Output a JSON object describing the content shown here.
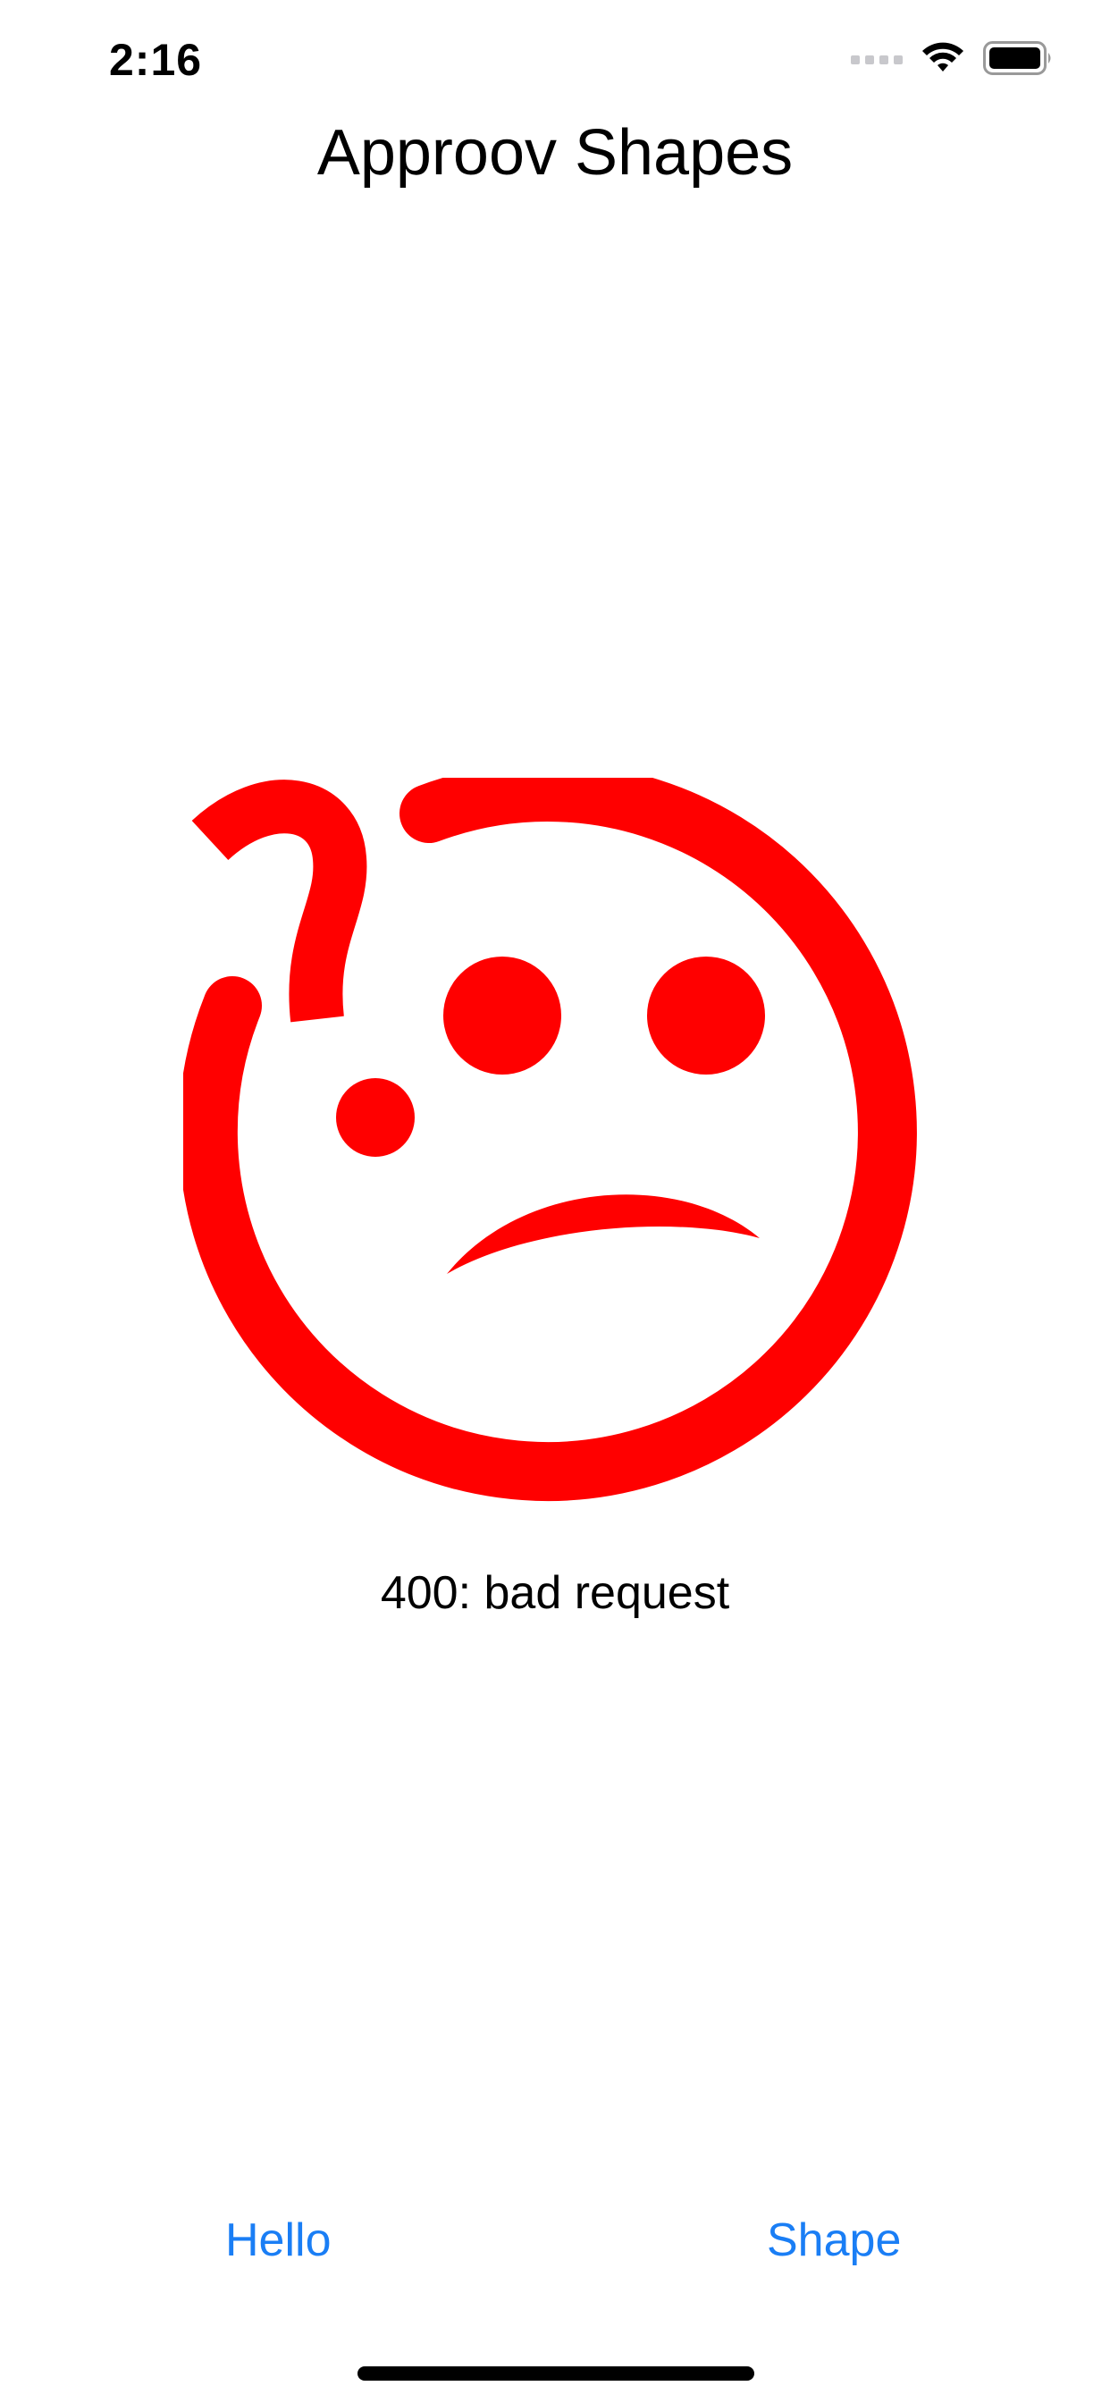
{
  "status_bar": {
    "time": "2:16",
    "icons": [
      "signal-icon",
      "wifi-icon",
      "battery-icon"
    ]
  },
  "header": {
    "title": "Approov Shapes"
  },
  "main": {
    "image": "confused-sad-face-icon",
    "image_color": "#ff0000",
    "message": "400: bad request"
  },
  "toolbar": {
    "hello_label": "Hello",
    "shape_label": "Shape",
    "accent_color": "#1a7ef5"
  }
}
